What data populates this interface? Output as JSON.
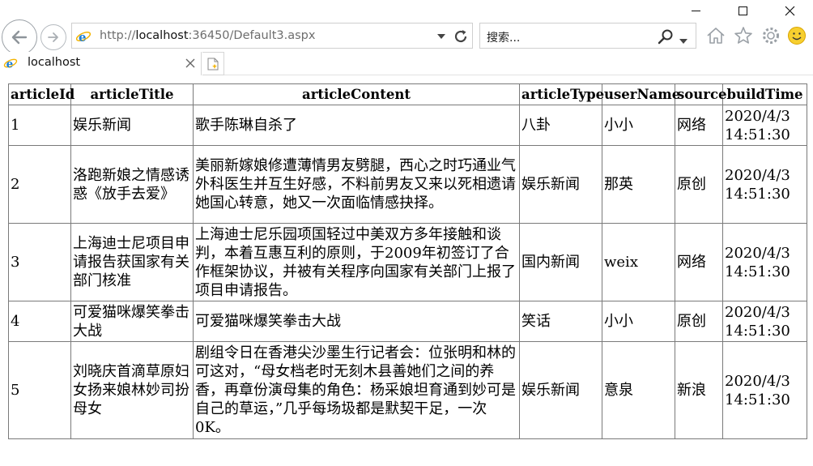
{
  "browser": {
    "address": {
      "scheme": "http://",
      "host": "localhost",
      "rest": ":36450/Default3.aspx"
    },
    "search": {
      "placeholder": "搜索..."
    },
    "tab": {
      "title": "localhost"
    }
  },
  "table": {
    "headers": [
      "articleId",
      "articleTitle",
      "articleContent",
      "articleType",
      "userName",
      "source",
      "buildTime"
    ],
    "rows": [
      {
        "id": "1",
        "title": "娱乐新闻",
        "content": "歌手陈琳自杀了",
        "type": "八卦",
        "user": "小小",
        "source": "网络",
        "time": "2020/4/3 14:51:30"
      },
      {
        "id": "2",
        "title": "洛跑新娘之情感诱惑《放手去爱》",
        "content": "美丽新嫁娘修遭薄情男友劈腿，西心之时巧通业气外科医生并互生好感，不料前男友又来以死相遗请她国心转意，她又一次面临情感抉择。",
        "type": "娱乐新闻",
        "user": "那英",
        "source": "原创",
        "time": "2020/4/3 14:51:30"
      },
      {
        "id": "3",
        "title": "上海迪士尼项目申请报告获国家有关部门核准",
        "content": "上海迪士尼乐园项国轻过中美双方多年接触和谈判，本着互惠互利的原则，于2009年初签订了合作框架协议，并被有关程序向国家有关部门上报了项目申请报告。",
        "type": "国内新闻",
        "user": "weix",
        "source": "网络",
        "time": "2020/4/3 14:51:30"
      },
      {
        "id": "4",
        "title": "可爱猫咪爆笑拳击大战",
        "content": "可爱猫咪爆笑拳击大战",
        "type": "笑话",
        "user": "小小",
        "source": "原创",
        "time": "2020/4/3 14:51:30"
      },
      {
        "id": "5",
        "title": "刘晓庆首滴草原妇女扬来娘林妙司扮母女",
        "content": "剧组令日在香港尖沙墨生行记者会：位张明和林的可这对，“母女档老时无刻木县善她们之间的养香，再章份演母集的角色：杨采娘坦育通到妙可是自己的草运，”几乎每场圾都是默契干足，一次0K。",
        "type": "娱乐新闻",
        "user": "意泉",
        "source": "新浪",
        "time": "2020/4/3 14:51:30"
      }
    ]
  }
}
